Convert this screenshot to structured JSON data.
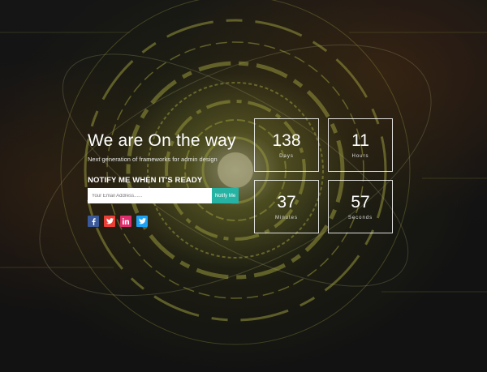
{
  "hero": {
    "title": "We are On the way",
    "subtitle": "Next generation of frameworks for admin design"
  },
  "notify": {
    "heading": "NOTIFY ME WHEN IT'S READY",
    "email_placeholder": "Your Email Address......",
    "button_label": "Notify Me"
  },
  "socials": [
    {
      "name": "facebook",
      "icon": "facebook-icon",
      "color": "#3b5998"
    },
    {
      "name": "twitter",
      "icon": "twitter-icon",
      "color": "#ea3f36"
    },
    {
      "name": "linkedin",
      "icon": "linkedin-icon",
      "color": "#e02d6b"
    },
    {
      "name": "twitter",
      "icon": "twitter-icon",
      "color": "#1da1f2"
    }
  ],
  "countdown": {
    "days": {
      "value": "138",
      "label": "Days"
    },
    "hours": {
      "value": "11",
      "label": "Hours"
    },
    "minutes": {
      "value": "37",
      "label": "Minutes"
    },
    "seconds": {
      "value": "57",
      "label": "Seconds"
    }
  },
  "colors": {
    "accent": "#26b3a4",
    "background": "#151515"
  }
}
